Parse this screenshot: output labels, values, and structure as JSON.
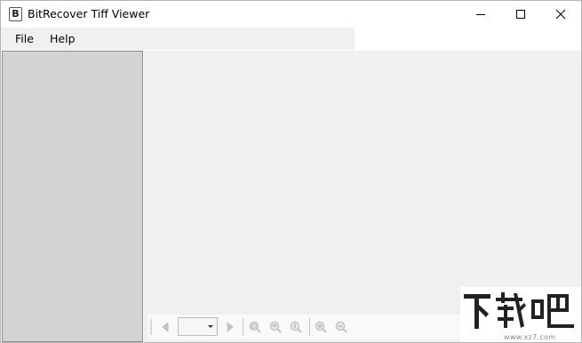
{
  "window": {
    "title": "BitRecover Tiff Viewer",
    "icon_letter": "B",
    "controls": [
      "minimize-icon",
      "maximize-icon",
      "close-icon"
    ]
  },
  "menu": {
    "items": [
      {
        "label": "File"
      },
      {
        "label": "Help"
      }
    ]
  },
  "toolbar": {
    "page_select_value": "",
    "icons": [
      "previous-page-icon",
      "next-page-icon",
      "fit-page-icon",
      "fit-width-icon",
      "actual-size-icon",
      "zoom-in-icon",
      "zoom-out-icon"
    ]
  },
  "watermark": {
    "site": "www.xz7.com",
    "logo": "下载吧 logo"
  },
  "colors": {
    "left_panel": "#d3d3d3",
    "viewer": "#f0f0f0",
    "menubar": "#f0f0f0",
    "disabled_icon": "#b8b8b8"
  }
}
